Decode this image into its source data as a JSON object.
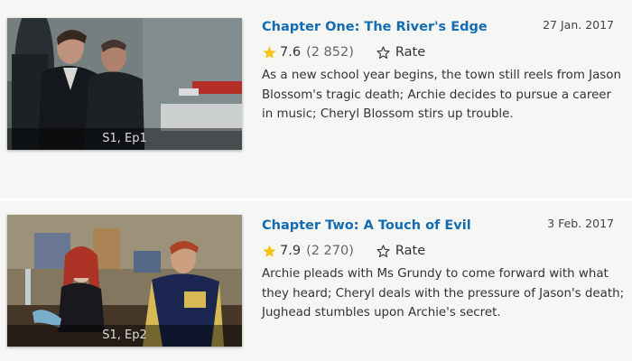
{
  "episodes": [
    {
      "title": "Chapter One: The River's Edge",
      "air_date": "27 Jan. 2017",
      "rating": "7.6",
      "votes": "(2 852)",
      "rate_label": "Rate",
      "label": "S1, Ep1",
      "plot": "As a new school year begins, the town still reels from Jason Blossom's tragic death; Archie decides to pursue a career in music; Cheryl Blossom stirs up trouble."
    },
    {
      "title": "Chapter Two: A Touch of Evil",
      "air_date": "3 Feb. 2017",
      "rating": "7.9",
      "votes": "(2 270)",
      "rate_label": "Rate",
      "label": "S1, Ep2",
      "plot": "Archie pleads with Ms Grundy to come forward with what they heard; Cheryl deals with the pressure of Jason's death; Jughead stumbles upon Archie's secret."
    }
  ],
  "colors": {
    "title_link": "#136cb2",
    "star_gold": "#f5c518",
    "row_background": "#f6f6f5"
  },
  "icons": {
    "rating": "filled-star-icon",
    "rate": "outline-star-icon"
  }
}
